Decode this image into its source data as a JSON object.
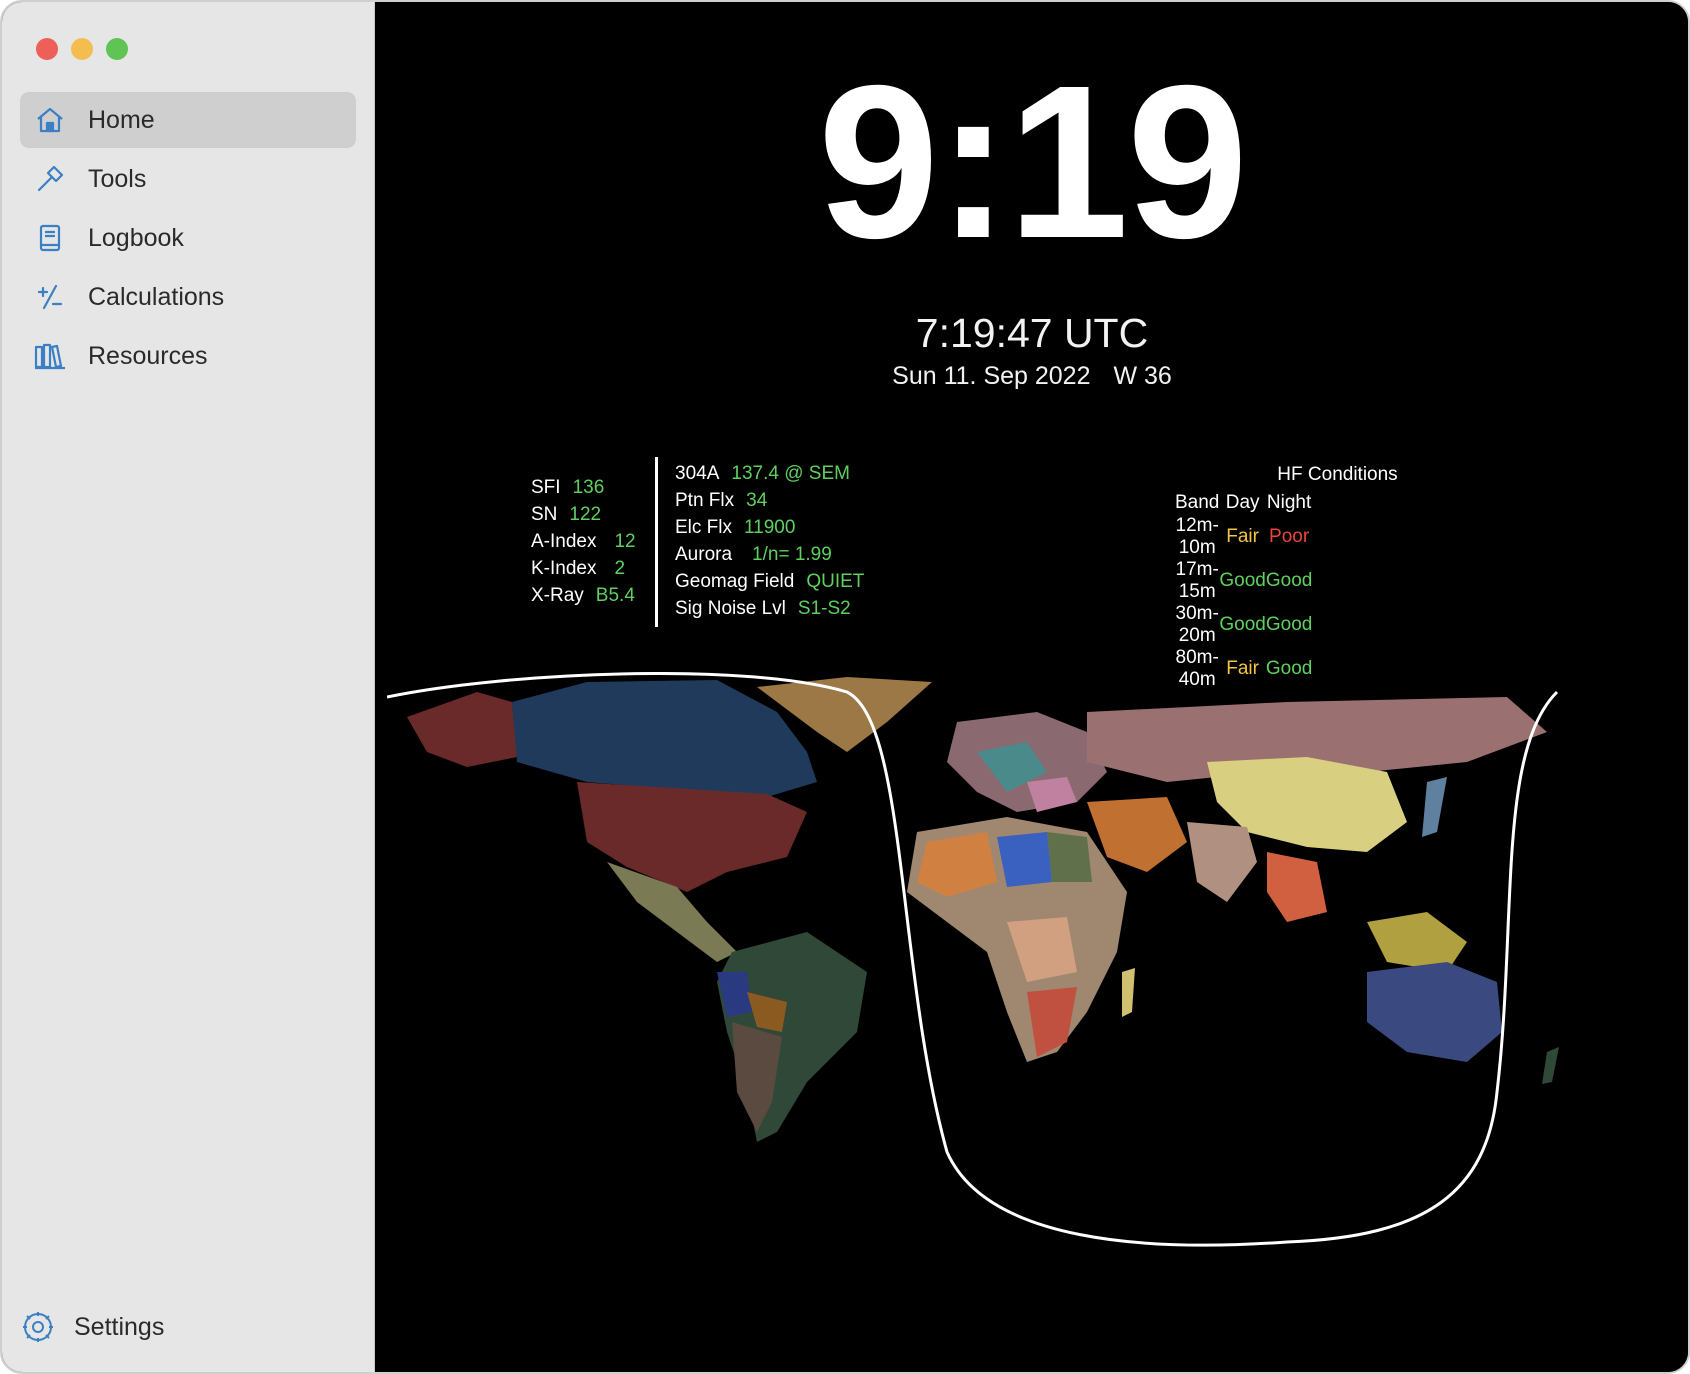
{
  "sidebar": {
    "items": [
      {
        "label": "Home",
        "icon": "house-icon",
        "active": true
      },
      {
        "label": "Tools",
        "icon": "hammer-icon",
        "active": false
      },
      {
        "label": "Logbook",
        "icon": "book-icon",
        "active": false
      },
      {
        "label": "Calculations",
        "icon": "plus-minus-icon",
        "active": false
      },
      {
        "label": "Resources",
        "icon": "books-icon",
        "active": false
      }
    ],
    "settings_label": "Settings"
  },
  "clock": {
    "local_time": "9:19",
    "utc_time": "7:19:47 UTC",
    "date": "Sun 11. Sep 2022",
    "week": "W 36"
  },
  "solar": [
    {
      "label": "SFI",
      "value": "136"
    },
    {
      "label": "SN",
      "value": "122"
    },
    {
      "label": "A-Index",
      "value": "12"
    },
    {
      "label": "K-Index",
      "value": "2"
    },
    {
      "label": "X-Ray",
      "value": "B5.4"
    }
  ],
  "flux": [
    {
      "label": "304A",
      "value": "137.4 @ SEM"
    },
    {
      "label": "Ptn Flx",
      "value": "34"
    },
    {
      "label": "Elc Flx",
      "value": "11900"
    },
    {
      "label": "Aurora",
      "value": "1/n= 1.99"
    },
    {
      "label": "Geomag Field",
      "value": "QUIET"
    },
    {
      "label": "Sig Noise Lvl",
      "value": "S1-S2"
    }
  ],
  "hf": {
    "title": "HF Conditions",
    "headers": [
      "Band",
      "Day",
      "Night"
    ],
    "rows": [
      {
        "band": "12m-10m",
        "day": "Fair",
        "night": "Poor"
      },
      {
        "band": "17m-15m",
        "day": "Good",
        "night": "Good"
      },
      {
        "band": "30m-20m",
        "day": "Good",
        "night": "Good"
      },
      {
        "band": "80m-40m",
        "day": "Fair",
        "night": "Good"
      }
    ]
  },
  "colors": {
    "good": "#5fd05f",
    "fair": "#f3c542",
    "poor": "#e8463c",
    "value": "#5fd05f"
  }
}
